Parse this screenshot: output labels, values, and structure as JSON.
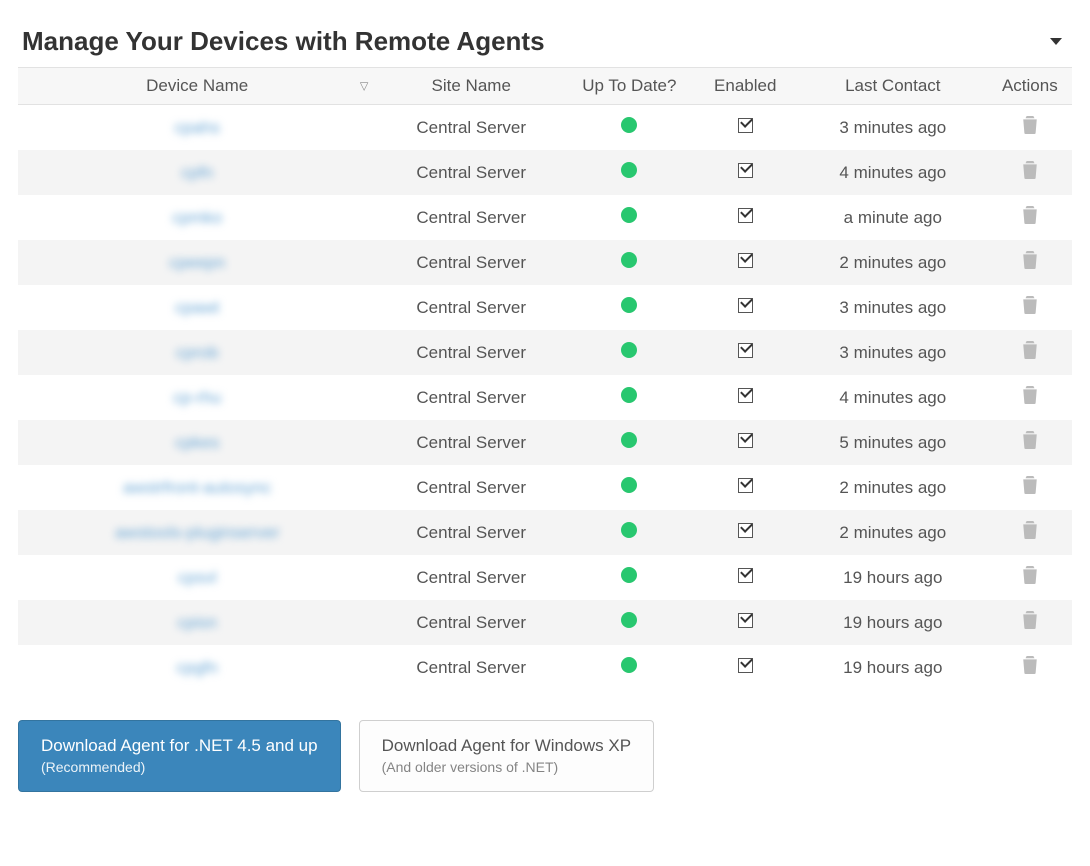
{
  "header": {
    "title": "Manage Your Devices with Remote Agents"
  },
  "columns": {
    "device": "Device Name",
    "site": "Site Name",
    "uptodate": "Up To Date?",
    "enabled": "Enabled",
    "last": "Last Contact",
    "actions": "Actions"
  },
  "rows": [
    {
      "device": "cpahs",
      "site": "Central Server",
      "uptodate": true,
      "enabled": true,
      "last": "3 minutes ago"
    },
    {
      "device": "cpfn",
      "site": "Central Server",
      "uptodate": true,
      "enabled": true,
      "last": "4 minutes ago"
    },
    {
      "device": "cpmko",
      "site": "Central Server",
      "uptodate": true,
      "enabled": true,
      "last": "a minute ago"
    },
    {
      "device": "cpeepn",
      "site": "Central Server",
      "uptodate": true,
      "enabled": true,
      "last": "2 minutes ago"
    },
    {
      "device": "cpawt",
      "site": "Central Server",
      "uptodate": true,
      "enabled": true,
      "last": "3 minutes ago"
    },
    {
      "device": "cprob",
      "site": "Central Server",
      "uptodate": true,
      "enabled": true,
      "last": "3 minutes ago"
    },
    {
      "device": "cp-rhu",
      "site": "Central Server",
      "uptodate": true,
      "enabled": true,
      "last": "4 minutes ago"
    },
    {
      "device": "cpkes",
      "site": "Central Server",
      "uptodate": true,
      "enabled": true,
      "last": "5 minutes ago"
    },
    {
      "device": "awstrfront-autosync",
      "site": "Central Server",
      "uptodate": true,
      "enabled": true,
      "last": "2 minutes ago"
    },
    {
      "device": "awstools-pluginserver",
      "site": "Central Server",
      "uptodate": true,
      "enabled": true,
      "last": "2 minutes ago"
    },
    {
      "device": "cpsvl",
      "site": "Central Server",
      "uptodate": true,
      "enabled": true,
      "last": "19 hours ago"
    },
    {
      "device": "cpisn",
      "site": "Central Server",
      "uptodate": true,
      "enabled": true,
      "last": "19 hours ago"
    },
    {
      "device": "cpgfn",
      "site": "Central Server",
      "uptodate": true,
      "enabled": true,
      "last": "19 hours ago"
    }
  ],
  "buttons": {
    "primary": {
      "label": "Download Agent for .NET 4.5 and up",
      "sub": "(Recommended)"
    },
    "secondary": {
      "label": "Download Agent for Windows XP",
      "sub": "(And older versions of .NET)"
    }
  },
  "colors": {
    "status_ok": "#28c76f",
    "primary": "#3b86bb"
  }
}
